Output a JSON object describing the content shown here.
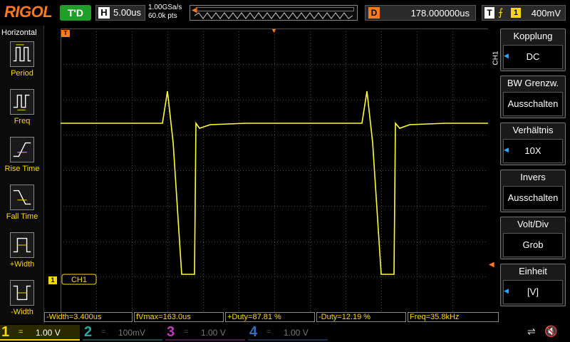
{
  "top": {
    "logo": "RIGOL",
    "run_status": "T'D",
    "horizontal_label": "H",
    "horizontal_scale": "5.00us",
    "sample_rate": "1.00GSa/s",
    "memory_depth": "60.0k pts",
    "delay_label": "D",
    "delay_value": "178.000000us",
    "trigger_label": "T",
    "trigger_edge_icon": "rising-edge-icon",
    "trigger_source": "1",
    "trigger_level": "400mV"
  },
  "left_panel": {
    "title": "Horizontal",
    "items": [
      {
        "label": "Period",
        "icon": "period-icon"
      },
      {
        "label": "Freq",
        "icon": "frequency-icon"
      },
      {
        "label": "Rise Time",
        "icon": "rise-time-icon"
      },
      {
        "label": "Fall Time",
        "icon": "fall-time-icon"
      },
      {
        "label": "+Width",
        "icon": "positive-width-icon"
      },
      {
        "label": "-Width",
        "icon": "negative-width-icon"
      }
    ]
  },
  "grid": {
    "channel_label": "CH1",
    "trace_color": "#ffff33",
    "grid_color": "#505050",
    "ch1_marker": "1",
    "trigger_marker": "T"
  },
  "right_panel": {
    "channel_tag": "CH1",
    "items": [
      {
        "label": "Kopplung",
        "value": "DC",
        "arrow": true
      },
      {
        "label": "BW Grenzw.",
        "value": "Ausschalten",
        "arrow": false
      },
      {
        "label": "Verhältnis",
        "value": "10X",
        "arrow": true
      },
      {
        "label": "Invers",
        "value": "Ausschalten",
        "arrow": false
      },
      {
        "label": "Volt/Div",
        "value": "Grob",
        "arrow": false
      },
      {
        "label": "Einheit",
        "value": "[V]",
        "arrow": true
      }
    ]
  },
  "measurements": [
    "-Width=3.400us",
    "fVmax=163.0us",
    "+Duty=87.81 %",
    "-Duty=12.19 %",
    "Freq=35.8kHz"
  ],
  "bottom": {
    "channels": [
      {
        "num": "1",
        "coupling": "=",
        "scale": "1.00 V",
        "color": "#ffd700",
        "active": true
      },
      {
        "num": "2",
        "coupling": "=",
        "scale": "100mV",
        "color": "#2aa7a0",
        "active": false
      },
      {
        "num": "3",
        "coupling": "=",
        "scale": "1.00 V",
        "color": "#c03ac0",
        "active": false
      },
      {
        "num": "4",
        "coupling": "=",
        "scale": "1.00 V",
        "color": "#3a6ec0",
        "active": false
      }
    ],
    "usb_icon": "usb-icon",
    "speaker_icon": "speaker-muted-icon"
  }
}
